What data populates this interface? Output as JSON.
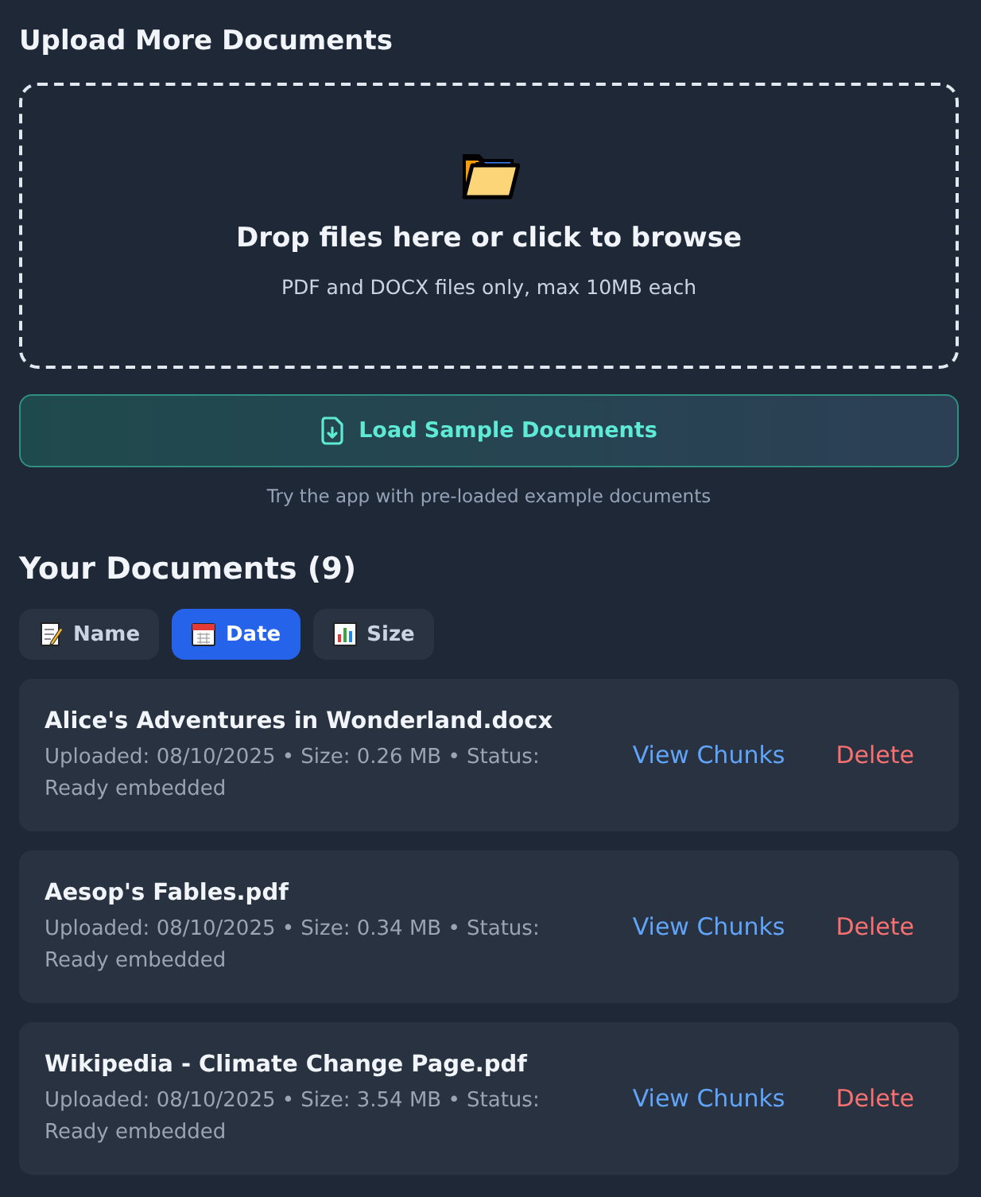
{
  "upload": {
    "title": "Upload More Documents",
    "dropzone": {
      "title": "Drop files here or click to browse",
      "hint": "PDF and DOCX files only, max 10MB each"
    },
    "sample_button": "Load Sample Documents",
    "sample_caption": "Try the app with pre-loaded example documents"
  },
  "documents": {
    "title": "Your Documents (9)",
    "sort_buttons": [
      {
        "label": "Name",
        "kind": "memo",
        "selected": false
      },
      {
        "label": "Date",
        "kind": "calendar",
        "selected": true
      },
      {
        "label": "Size",
        "kind": "chart",
        "selected": false
      }
    ],
    "items": [
      {
        "name": "Alice's Adventures in Wonderland.docx",
        "meta": "Uploaded: 08/10/2025 • Size: 0.26 MB • Status: Ready embedded",
        "view": "View Chunks",
        "delete": "Delete"
      },
      {
        "name": "Aesop's Fables.pdf",
        "meta": "Uploaded: 08/10/2025 • Size: 0.34 MB • Status: Ready embedded",
        "view": "View Chunks",
        "delete": "Delete"
      },
      {
        "name": "Wikipedia - Climate Change Page.pdf",
        "meta": "Uploaded: 08/10/2025 • Size: 3.54 MB • Status: Ready embedded",
        "view": "View Chunks",
        "delete": "Delete"
      }
    ]
  }
}
